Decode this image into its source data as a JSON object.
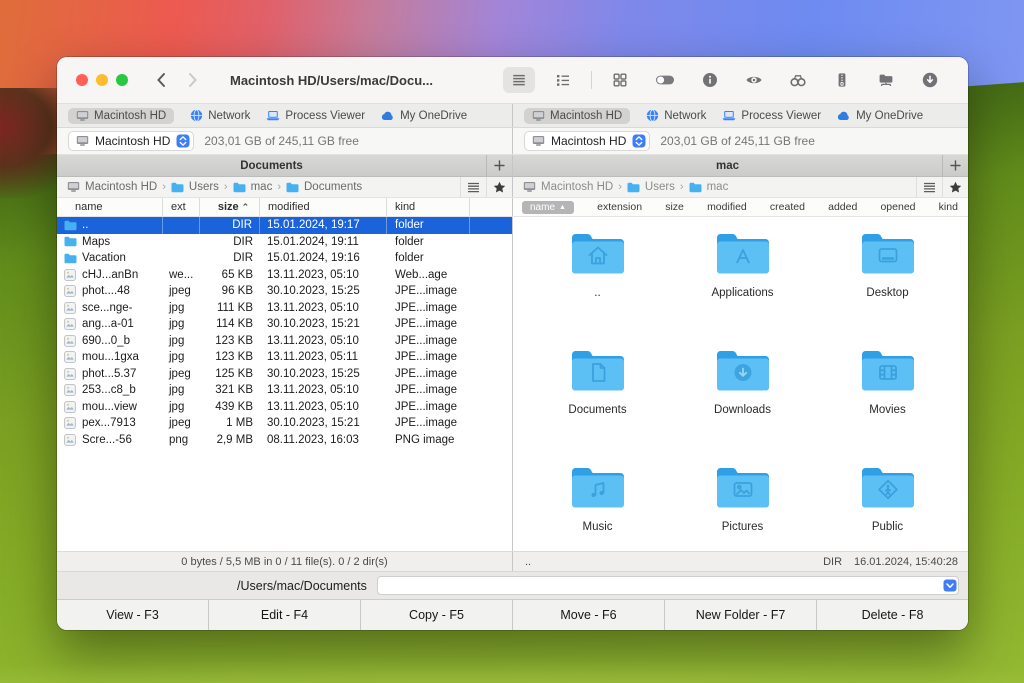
{
  "window": {
    "title": "Macintosh HD/Users/mac/Docu...",
    "traffic_lights": [
      "#ff5f57",
      "#febc2e",
      "#28c840"
    ],
    "toolbar": [
      {
        "name": "list-view",
        "active": true
      },
      {
        "name": "column-view"
      },
      {
        "name": "divider"
      },
      {
        "name": "grid-view"
      },
      {
        "name": "toggle-switch"
      },
      {
        "name": "info"
      },
      {
        "name": "preview-eye"
      },
      {
        "name": "search-binoculars"
      },
      {
        "name": "archive-zip"
      },
      {
        "name": "network-share"
      },
      {
        "name": "download"
      }
    ]
  },
  "pane_tabs": [
    {
      "label": "Macintosh HD",
      "icon": "computer",
      "selected": true
    },
    {
      "label": "Network",
      "icon": "globe"
    },
    {
      "label": "Process Viewer",
      "icon": "laptop"
    },
    {
      "label": "My OneDrive",
      "icon": "cloud"
    }
  ],
  "crumb_separator": "›",
  "left_pane": {
    "drive": {
      "name": "Macintosh HD",
      "free": "203,01 GB of 245,11 GB free"
    },
    "tab_title": "Documents",
    "breadcrumb": [
      {
        "label": "Macintosh HD",
        "icon": "computer"
      },
      {
        "label": "Users",
        "icon": "folder"
      },
      {
        "label": "mac",
        "icon": "folder"
      },
      {
        "label": "Documents",
        "icon": "folder"
      }
    ],
    "columns": [
      {
        "label": "name"
      },
      {
        "label": "ext"
      },
      {
        "label": "size",
        "sorted": true
      },
      {
        "label": "modified"
      },
      {
        "label": "kind"
      }
    ],
    "sort_caret": "⌃",
    "rows": [
      {
        "name": "..",
        "ext": "",
        "size": "DIR",
        "modified": "15.01.2024, 19:17",
        "kind": "folder",
        "icon": "folder",
        "selected": true
      },
      {
        "name": "Maps",
        "ext": "",
        "size": "DIR",
        "modified": "15.01.2024, 19:11",
        "kind": "folder",
        "icon": "folder"
      },
      {
        "name": "Vacation",
        "ext": "",
        "size": "DIR",
        "modified": "15.01.2024, 19:16",
        "kind": "folder",
        "icon": "folder"
      },
      {
        "name": "cHJ...anBn",
        "ext": "we...",
        "size": "65 KB",
        "modified": "13.11.2023, 05:10",
        "kind": "Web...age",
        "icon": "image"
      },
      {
        "name": "phot....48",
        "ext": "jpeg",
        "size": "96 KB",
        "modified": "30.10.2023, 15:25",
        "kind": "JPE...image",
        "icon": "image"
      },
      {
        "name": "sce...nge-",
        "ext": "jpg",
        "size": "111 KB",
        "modified": "13.11.2023, 05:10",
        "kind": "JPE...image",
        "icon": "image"
      },
      {
        "name": "ang...a-01",
        "ext": "jpg",
        "size": "114 KB",
        "modified": "30.10.2023, 15:21",
        "kind": "JPE...image",
        "icon": "image"
      },
      {
        "name": "690...0_b",
        "ext": "jpg",
        "size": "123 KB",
        "modified": "13.11.2023, 05:10",
        "kind": "JPE...image",
        "icon": "image"
      },
      {
        "name": "mou...1gxa",
        "ext": "jpg",
        "size": "123 KB",
        "modified": "13.11.2023, 05:11",
        "kind": "JPE...image",
        "icon": "image"
      },
      {
        "name": "phot...5.37",
        "ext": "jpeg",
        "size": "125 KB",
        "modified": "30.10.2023, 15:25",
        "kind": "JPE...image",
        "icon": "image"
      },
      {
        "name": "253...c8_b",
        "ext": "jpg",
        "size": "321 KB",
        "modified": "13.11.2023, 05:10",
        "kind": "JPE...image",
        "icon": "image"
      },
      {
        "name": "mou...view",
        "ext": "jpg",
        "size": "439 KB",
        "modified": "13.11.2023, 05:10",
        "kind": "JPE...image",
        "icon": "image"
      },
      {
        "name": "pex...7913",
        "ext": "jpeg",
        "size": "1 MB",
        "modified": "30.10.2023, 15:21",
        "kind": "JPE...image",
        "icon": "image"
      },
      {
        "name": "Scre...-56",
        "ext": "png",
        "size": "2,9 MB",
        "modified": "08.11.2023, 16:03",
        "kind": "PNG image",
        "icon": "image"
      }
    ],
    "status": "0 bytes / 5,5 MB in 0 / 11 file(s). 0 / 2 dir(s)"
  },
  "right_pane": {
    "drive": {
      "name": "Macintosh HD",
      "free": "203,01 GB of 245,11 GB free"
    },
    "tab_title": "mac",
    "breadcrumb": [
      {
        "label": "Macintosh HD",
        "icon": "computer"
      },
      {
        "label": "Users",
        "icon": "folder"
      },
      {
        "label": "mac",
        "icon": "folder"
      }
    ],
    "columns": [
      {
        "label": "name",
        "sorted": true
      },
      {
        "label": "extension"
      },
      {
        "label": "size"
      },
      {
        "label": "modified"
      },
      {
        "label": "created"
      },
      {
        "label": "added"
      },
      {
        "label": "opened"
      },
      {
        "label": "kind"
      }
    ],
    "sort_caret": "▲",
    "folders": [
      {
        "label": "..",
        "emblem": "home"
      },
      {
        "label": "Applications",
        "emblem": "appstore"
      },
      {
        "label": "Desktop",
        "emblem": "desktop"
      },
      {
        "label": "Documents",
        "emblem": "document"
      },
      {
        "label": "Downloads",
        "emblem": "download"
      },
      {
        "label": "Movies",
        "emblem": "film"
      },
      {
        "label": "Music",
        "emblem": "music"
      },
      {
        "label": "Pictures",
        "emblem": "picture"
      },
      {
        "label": "Public",
        "emblem": "public"
      }
    ],
    "status": {
      "name": "..",
      "size": "DIR",
      "modified": "16.01.2024, 15:40:28"
    }
  },
  "command_bar": {
    "path_label": "/Users/mac/Documents",
    "input_value": ""
  },
  "function_buttons": [
    "View - F3",
    "Edit - F4",
    "Copy - F5",
    "Move - F6",
    "New Folder - F7",
    "Delete - F8"
  ],
  "colors": {
    "accent_blue": "#3d7ef7",
    "selection_blue": "#1b63da",
    "folder_blue": "#5cc0f4"
  }
}
